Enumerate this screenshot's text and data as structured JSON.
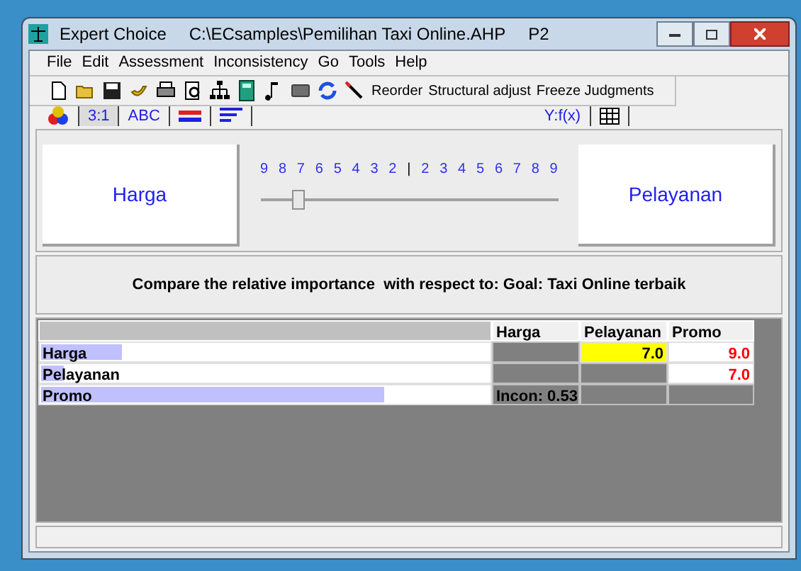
{
  "window": {
    "app": "Expert Choice",
    "file": "C:\\ECsamples\\Pemilihan Taxi Online.AHP",
    "node": "P2"
  },
  "menu": [
    "File",
    "Edit",
    "Assessment",
    "Inconsistency",
    "Go",
    "Tools",
    "Help"
  ],
  "toolbar": {
    "buttons": [
      "Reorder",
      "Structural adjust",
      "Freeze Judgments"
    ]
  },
  "tabs": [
    {
      "kind": "icon",
      "selected": false
    },
    {
      "kind": "text",
      "label": "3:1",
      "selected": true
    },
    {
      "kind": "text",
      "label": "ABC",
      "selected": false
    },
    {
      "kind": "bars",
      "selected": false
    },
    {
      "kind": "lines",
      "selected": false
    },
    {
      "kind": "text",
      "label": "Y:f(x)",
      "selected": false
    },
    {
      "kind": "grid",
      "selected": false
    }
  ],
  "comparison": {
    "left": "Harga",
    "right": "Pelayanan",
    "scale": [
      "9",
      "8",
      "7",
      "6",
      "5",
      "4",
      "3",
      "2",
      "|",
      "2",
      "3",
      "4",
      "5",
      "6",
      "7",
      "8",
      "9"
    ],
    "level": 0.125,
    "prompt": "Compare the relative importance  with respect to: Goal: Taxi Online terbaik"
  },
  "matrix": {
    "columns": [
      "Harga",
      "Pelayanan",
      "Promo"
    ],
    "rows": [
      {
        "name": "Harga",
        "level": 0.18,
        "cells": [
          {
            "kind": "blank"
          },
          {
            "kind": "value",
            "text": "7.0",
            "inverse": false,
            "selected": true
          },
          {
            "kind": "value",
            "text": "9.0",
            "inverse": true,
            "selected": false
          }
        ]
      },
      {
        "name": "Pelayanan",
        "level": 0.05,
        "cells": [
          {
            "kind": "blank"
          },
          {
            "kind": "blank"
          },
          {
            "kind": "value",
            "text": "7.0",
            "inverse": true,
            "selected": false
          }
        ]
      },
      {
        "name": "Promo",
        "level": 0.76,
        "cells": [
          {
            "kind": "note",
            "text": "Incon: 0.53"
          },
          {
            "kind": "blank"
          },
          {
            "kind": "blank"
          }
        ]
      }
    ]
  }
}
